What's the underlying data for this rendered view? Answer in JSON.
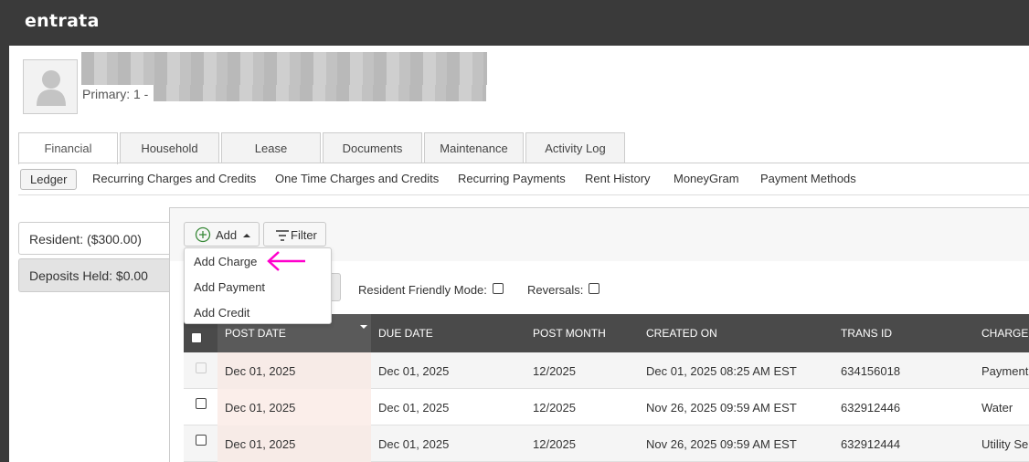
{
  "header": {
    "logo": "entrata"
  },
  "resident": {
    "primary_label": "Primary: 1 -"
  },
  "tabs": [
    {
      "label": "Financial"
    },
    {
      "label": "Household"
    },
    {
      "label": "Lease"
    },
    {
      "label": "Documents"
    },
    {
      "label": "Maintenance"
    },
    {
      "label": "Activity Log"
    }
  ],
  "subnav": [
    {
      "label": "Ledger"
    },
    {
      "label": "Recurring Charges and Credits"
    },
    {
      "label": "One Time Charges and Credits"
    },
    {
      "label": "Recurring Payments"
    },
    {
      "label": "Rent History"
    },
    {
      "label": "MoneyGram"
    },
    {
      "label": "Payment Methods"
    }
  ],
  "balances": {
    "resident": "Resident: ($300.00)",
    "deposits": "Deposits Held: $0.00"
  },
  "toolbar": {
    "add_label": "Add",
    "filter_label": "Filter"
  },
  "add_menu": [
    "Add Charge",
    "Add Payment",
    "Add Credit"
  ],
  "filters": {
    "resident_friendly": "Resident Friendly Mode:",
    "reversals": "Reversals:"
  },
  "table": {
    "columns": [
      "POST DATE",
      "DUE DATE",
      "POST MONTH",
      "CREATED ON",
      "TRANS ID",
      "CHARGE C"
    ],
    "rows": [
      [
        "Dec 01, 2025",
        "Dec 01, 2025",
        "12/2025",
        "Dec 01, 2025 08:25 AM EST",
        "634156018",
        "Payment"
      ],
      [
        "Dec 01, 2025",
        "Dec 01, 2025",
        "12/2025",
        "Nov 26, 2025 09:59 AM EST",
        "632912446",
        "Water"
      ],
      [
        "Dec 01, 2025",
        "Dec 01, 2025",
        "12/2025",
        "Nov 26, 2025 09:59 AM EST",
        "632912444",
        "Utility Ser"
      ]
    ]
  },
  "colors": {
    "annotation_arrow": "#ff00cc",
    "header_bg": "#3a3a3a",
    "add_icon": "#3a8a3a"
  }
}
